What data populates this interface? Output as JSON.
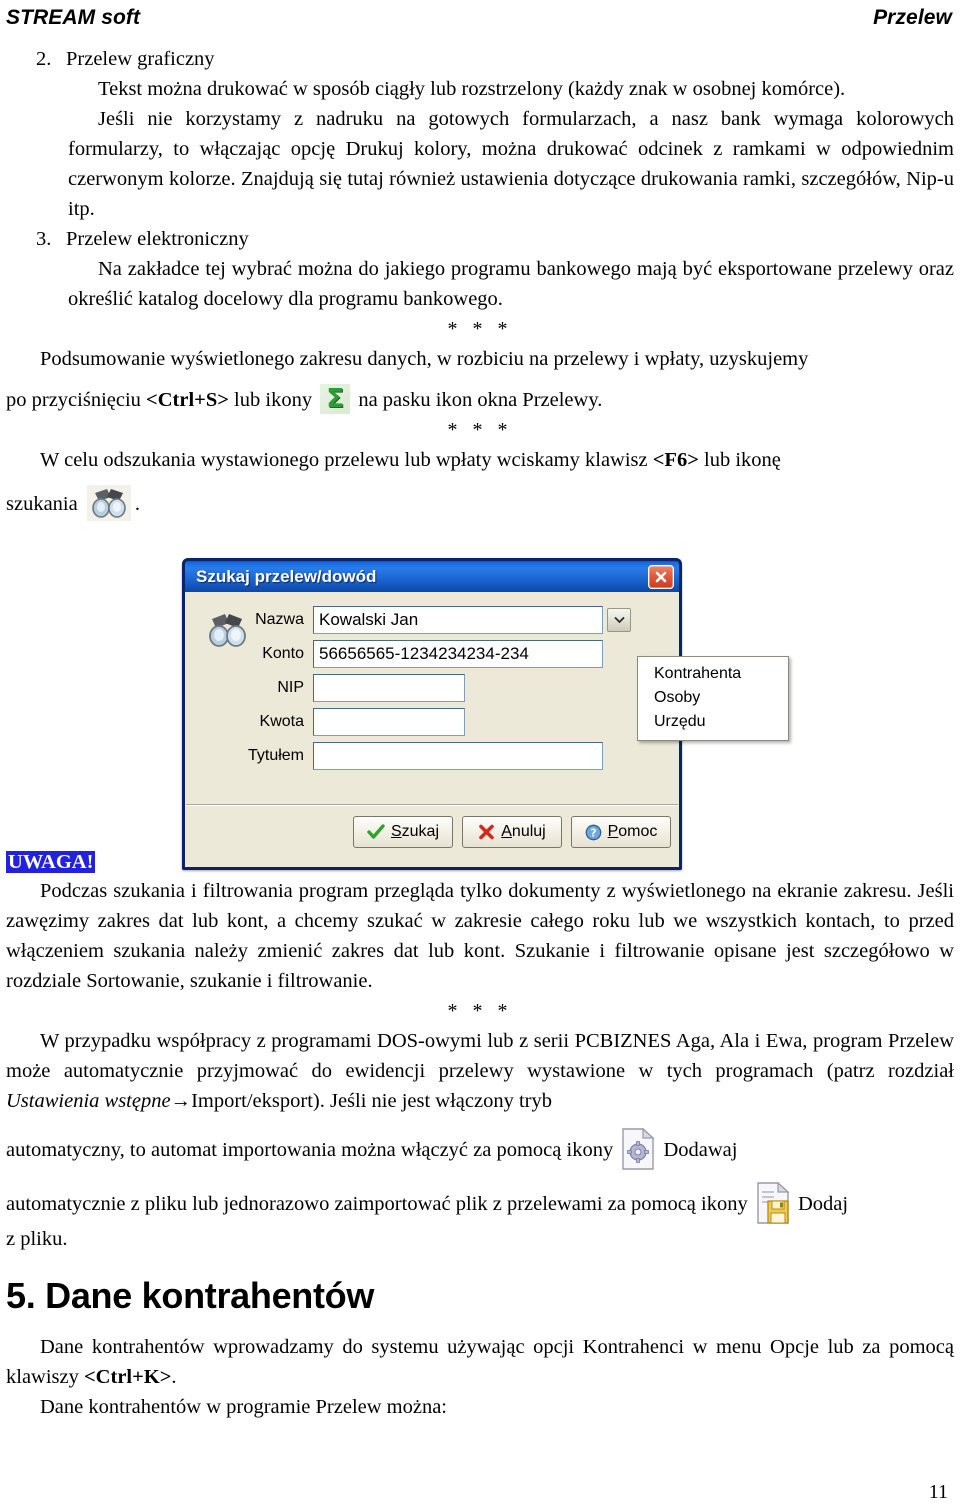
{
  "header": {
    "left": "STREAM soft",
    "right": "Przelew"
  },
  "sections": {
    "item2_num": "2.",
    "item2_label": "Przelew graficzny",
    "item2_p1": "Tekst można drukować w sposób ciągły lub rozstrzelony (każdy znak w osobnej komórce).",
    "item2_p2": "Jeśli nie korzystamy z nadruku na gotowych formularzach, a nasz bank wymaga kolorowych formularzy, to włączając opcję Drukuj kolory, można drukować odcinek z ramkami w odpowiednim czerwonym kolorze. Znajdują się tutaj również ustawienia dotyczące drukowania ramki, szczegółów, Nip-u itp.",
    "item3_num": "3.",
    "item3_label": "Przelew elektroniczny",
    "item3_p1": "Na zakładce tej wybrać można do jakiego programu bankowego mają być eksportowane przelewy oraz określić katalog docelowy dla programu bankowego.",
    "stars": "* * *",
    "summary_p1": "Podsumowanie wyświetlonego zakresu danych, w rozbiciu na przelewy i wpłaty, uzyskujemy",
    "summary_p2_a": "po przyciśnięciu ",
    "summary_shortcut": "<Ctrl+S>",
    "summary_p2_b": " lub ikony ",
    "summary_p2_c": " na pasku ikon okna Przelewy.",
    "search_p_a": "W celu odszukania wystawionego przelewu lub wpłaty wciskamy klawisz ",
    "search_shortcut": "<F6>",
    "search_p_b": " lub ikonę",
    "search_p_c": "szukania",
    "search_p_d": ".",
    "uwaga_label": "UWAGA!",
    "uwaga_text": "Podczas szukania i filtrowania program przegląda tylko dokumenty z wyświetlonego na ekranie zakresu. Jeśli zawęzimy zakres dat lub kont, a chcemy szukać w zakresie całego roku lub we wszystkich kontach, to przed włączeniem szukania należy zmienić zakres dat lub kont. Szukanie i filtrowanie opisane jest szczegółowo w rozdziale Sortowanie, szukanie i filtrowanie.",
    "import_p_a": "W przypadku współpracy z programami DOS-owymi lub z serii PCBIZNES Aga, Ala i Ewa, program Przelew może automatycznie przyjmować do ewidencji przelewy wystawione w tych programach (patrz rozdział ",
    "import_italic": "Ustawienia wstępne",
    "import_arrow": "→",
    "import_p_b": "Import/eksport). Jeśli nie jest włączony tryb",
    "import_p_c": "automatyczny, to automat importowania można włączyć za pomocą ikony ",
    "import_p_d": " Dodawaj",
    "import_p_e": "automatycznie z pliku lub jednorazowo zaimportować plik z przelewami za pomocą ikony ",
    "import_p_f": " Dodaj",
    "import_p_g": "z pliku.",
    "h5": "5. Dane kontrahentów",
    "kontr_p1_a": "Dane kontrahentów wprowadzamy do systemu używając opcji Kontrahenci w menu Opcje lub za pomocą klawiszy ",
    "kontr_shortcut": "<Ctrl+K>",
    "kontr_p1_b": ".",
    "kontr_p2": "Dane kontrahentów w programie Przelew można:"
  },
  "dialog": {
    "title": "Szukaj przelew/dowód",
    "close_label": "×",
    "fields": [
      {
        "label": "Nazwa",
        "value": "Kowalski Jan",
        "width": "wide"
      },
      {
        "label": "Konto",
        "value": "56656565-1234234234-234",
        "width": "wide"
      },
      {
        "label": "NIP",
        "value": "",
        "width": "narrow"
      },
      {
        "label": "Kwota",
        "value": "",
        "width": "narrow"
      },
      {
        "label": "Tytułem",
        "value": "",
        "width": "wide"
      }
    ],
    "dropdown_items": [
      "Kontrahenta",
      "Osoby",
      "Urzędu"
    ],
    "buttons": [
      {
        "label_pre": "",
        "label_accel": "S",
        "label_post": "zukaj",
        "icon": "check-icon"
      },
      {
        "label_pre": "",
        "label_accel": "A",
        "label_post": "nuluj",
        "icon": "cross-icon"
      },
      {
        "label_pre": "",
        "label_accel": "P",
        "label_post": "omoc",
        "icon": "help-icon"
      }
    ]
  },
  "footer": {
    "page_number": "11"
  },
  "colors": {
    "titlebar": "#1d6ee0",
    "dialog_face": "#ece9d8",
    "highlight": "#2222dd",
    "sigma_green": "#2e9c35",
    "close_red": "#c93d1e"
  }
}
